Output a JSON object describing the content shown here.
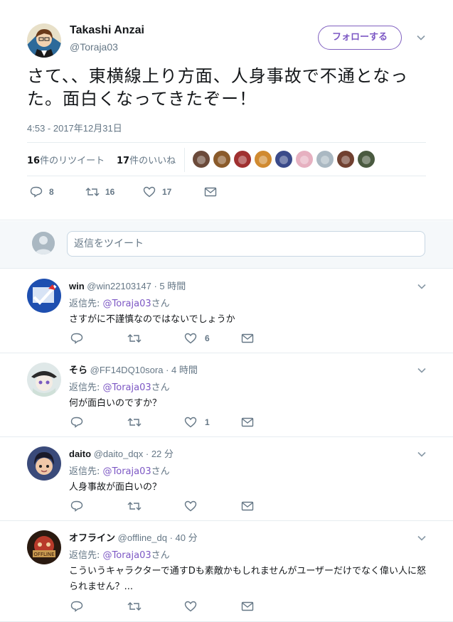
{
  "main_tweet": {
    "name": "Takashi Anzai",
    "handle": "@Toraja03",
    "follow_label": "フォローする",
    "text": "さて、、東横線上り方面、人身事故で不通となった。面白くなってきたぞー！",
    "timestamp": "4:53 - 2017年12月31日",
    "retweet_count": "16",
    "retweet_label": "件のリツイート",
    "like_count": "17",
    "like_label": "件のいいね",
    "actions": {
      "reply": "8",
      "retweet": "16",
      "like": "17"
    },
    "likers": [
      "#6b4a3a",
      "#8a5a2a",
      "#a03030",
      "#d08a30",
      "#3a4a8a",
      "#e6b0c0",
      "#aab8c2",
      "#704030",
      "#4a5a40"
    ]
  },
  "reply_box": {
    "placeholder": "返信をツイート"
  },
  "reply_prefix": "返信先:",
  "reply_suffix": "さん",
  "reply_to_handle": "@Toraja03",
  "replies": [
    {
      "name": "win",
      "handle": "@win22103147",
      "time": "· 5 時間",
      "text": "さすがに不謹慎なのではないでしょうか",
      "likes": "6"
    },
    {
      "name": "そら",
      "handle": "@FF14DQ10sora",
      "time": "· 4 時間",
      "text": "何が面白いのですか？",
      "likes": "1"
    },
    {
      "name": "daito",
      "handle": "@daito_dqx",
      "time": "· 22 分",
      "text": "人身事故が面白いの？",
      "likes": ""
    },
    {
      "name": "オフライン",
      "handle": "@offline_dq",
      "time": "· 40 分",
      "text": "こういうキャラクターで通すDも素敵かもしれませんがユーザーだけでなく偉い人に怒られません？...",
      "likes": ""
    }
  ],
  "colors": {
    "accent": "#7c57c4",
    "muted": "#657786",
    "border": "#e6ecf0"
  }
}
